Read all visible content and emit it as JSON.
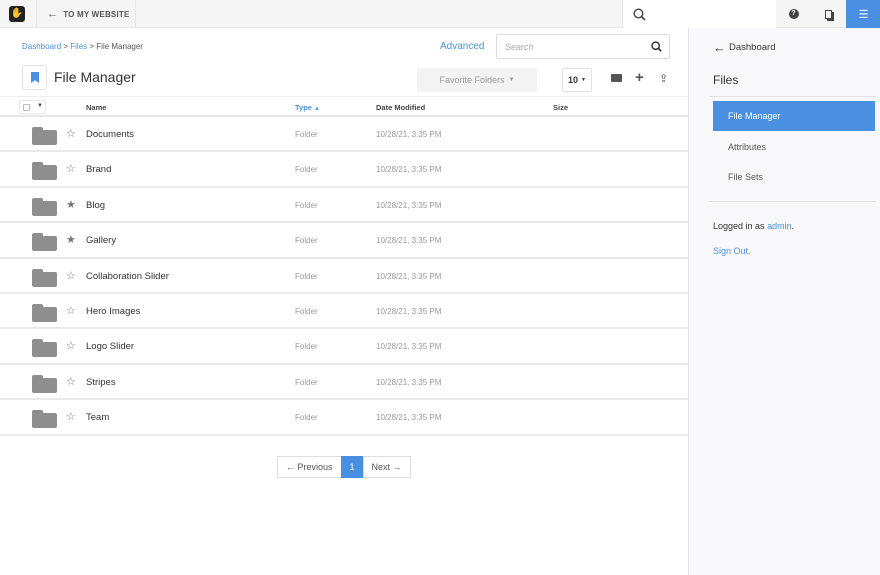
{
  "topbar": {
    "back_label": "TO MY WEBSITE"
  },
  "breadcrumb": [
    "Dashboard",
    "Files",
    "File Manager"
  ],
  "page_title": "File Manager",
  "advanced_label": "Advanced",
  "search_placeholder": "Search",
  "favorite_folders_label": "Favorite Folders",
  "per_page": "10",
  "columns": {
    "name": "Name",
    "type": "Type",
    "date": "Date Modified",
    "size": "Size"
  },
  "rows": [
    {
      "name": "Documents",
      "type": "Folder",
      "date": "10/28/21, 3:35 PM",
      "starred": false
    },
    {
      "name": "Brand",
      "type": "Folder",
      "date": "10/28/21, 3:35 PM",
      "starred": false
    },
    {
      "name": "Blog",
      "type": "Folder",
      "date": "10/28/21, 3:35 PM",
      "starred": true
    },
    {
      "name": "Gallery",
      "type": "Folder",
      "date": "10/28/21, 3:35 PM",
      "starred": true
    },
    {
      "name": "Collaboration Slider",
      "type": "Folder",
      "date": "10/28/21, 3:35 PM",
      "starred": false
    },
    {
      "name": "Hero Images",
      "type": "Folder",
      "date": "10/28/21, 3:35 PM",
      "starred": false
    },
    {
      "name": "Logo Slider",
      "type": "Folder",
      "date": "10/28/21, 3:35 PM",
      "starred": false
    },
    {
      "name": "Stripes",
      "type": "Folder",
      "date": "10/28/21, 3:35 PM",
      "starred": false
    },
    {
      "name": "Team",
      "type": "Folder",
      "date": "10/28/21, 3:35 PM",
      "starred": false
    }
  ],
  "pagination": {
    "previous": "← Previous",
    "current": "1",
    "next": "Next →"
  },
  "sidebar": {
    "back": "Dashboard",
    "heading": "Files",
    "items": [
      "File Manager",
      "Attributes",
      "File Sets"
    ],
    "logged_in_prefix": "Logged in as",
    "user": "admin",
    "sign_out": "Sign Out."
  },
  "colors": {
    "accent": "#4a90e2"
  }
}
